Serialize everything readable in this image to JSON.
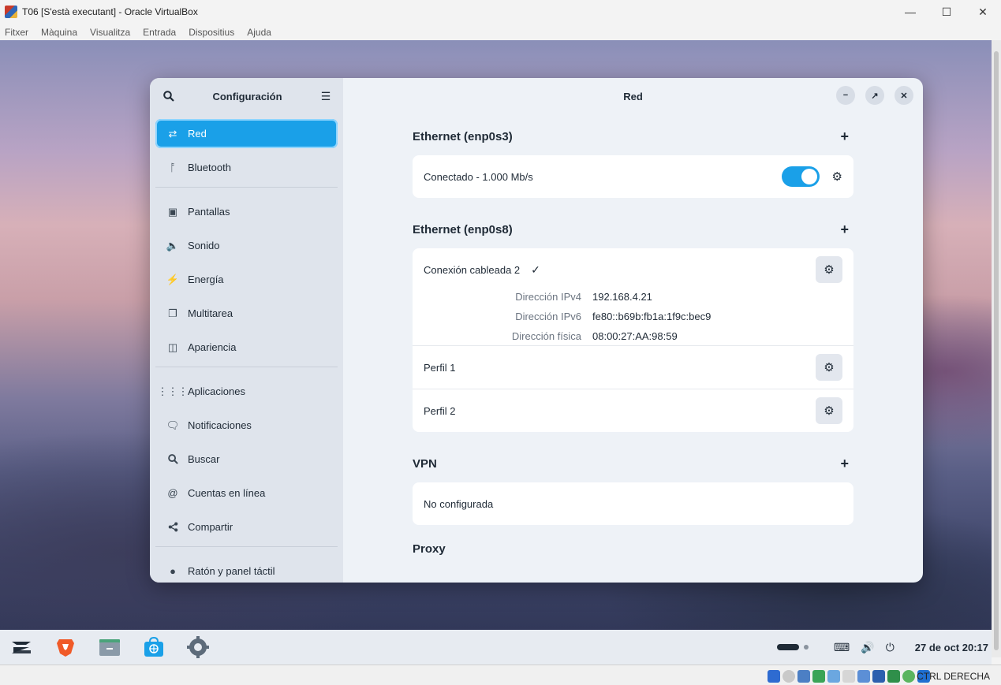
{
  "host": {
    "title": "T06 [S'està executant] - Oracle VirtualBox",
    "menu": [
      "Fitxer",
      "Màquina",
      "Visualitza",
      "Entrada",
      "Dispositius",
      "Ajuda"
    ],
    "status_label": "CTRL DERECHA"
  },
  "sidebar": {
    "title": "Configuración",
    "items": [
      {
        "label": "Red",
        "icon": "network-icon",
        "active": true
      },
      {
        "label": "Bluetooth",
        "icon": "bluetooth-icon"
      },
      {
        "label": "Pantallas",
        "icon": "display-icon"
      },
      {
        "label": "Sonido",
        "icon": "speaker-icon"
      },
      {
        "label": "Energía",
        "icon": "power-icon"
      },
      {
        "label": "Multitarea",
        "icon": "multitask-icon"
      },
      {
        "label": "Apariencia",
        "icon": "appearance-icon"
      },
      {
        "label": "Aplicaciones",
        "icon": "apps-grid-icon"
      },
      {
        "label": "Notificaciones",
        "icon": "notification-icon"
      },
      {
        "label": "Buscar",
        "icon": "search-icon"
      },
      {
        "label": "Cuentas en línea",
        "icon": "at-icon"
      },
      {
        "label": "Compartir",
        "icon": "share-icon"
      },
      {
        "label": "Ratón y panel táctil",
        "icon": "mouse-icon"
      }
    ]
  },
  "main": {
    "title": "Red",
    "eth1": {
      "title": "Ethernet (enp0s3)",
      "status": "Conectado - 1.000 Mb/s",
      "toggle_on": true
    },
    "eth2": {
      "title": "Ethernet (enp0s8)",
      "connection": "Conexión cableada 2",
      "details": [
        {
          "key": "Dirección IPv4",
          "value": "192.168.4.21"
        },
        {
          "key": "Dirección IPv6",
          "value": "fe80::b69b:fb1a:1f9c:bec9"
        },
        {
          "key": "Dirección física",
          "value": "08:00:27:AA:98:59"
        }
      ],
      "profiles": [
        "Perfil 1",
        "Perfil 2"
      ]
    },
    "vpn": {
      "title": "VPN",
      "status": "No configurada"
    },
    "proxy": {
      "title": "Proxy"
    }
  },
  "taskbar": {
    "clock": "27 de oct  20:17"
  },
  "colors": {
    "accent": "#1aa0e8"
  }
}
